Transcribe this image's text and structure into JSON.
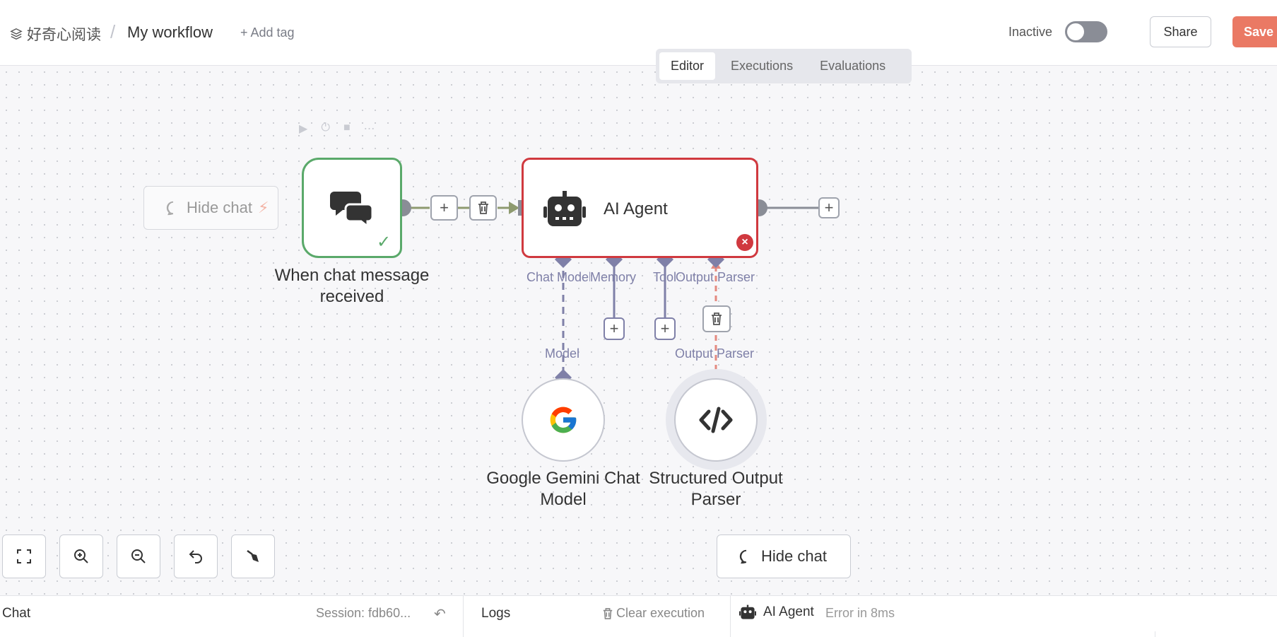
{
  "header": {
    "project_name": "好奇心阅读",
    "separator": "/",
    "workflow_name": "My workflow",
    "add_tag": "+ Add tag",
    "status_label": "Inactive",
    "share_label": "Share",
    "save_label": "Save"
  },
  "tabs": [
    {
      "label": "Editor",
      "active": true
    },
    {
      "label": "Executions",
      "active": false
    },
    {
      "label": "Evaluations",
      "active": false
    }
  ],
  "nodes": {
    "trigger": {
      "label": "When chat message received",
      "status": "success"
    },
    "agent": {
      "label": "AI Agent",
      "status": "error"
    },
    "gemini": {
      "label": "Google Gemini Chat Model"
    },
    "parser": {
      "label": "Structured Output Parser"
    }
  },
  "ports": {
    "chat_model": "Chat Model",
    "memory": "Memory",
    "tool": "Tool",
    "output_parser": "Output Parser",
    "model": "Model",
    "output_parser_in": "Output Parser"
  },
  "canvas": {
    "hide_chat_ghost": "Hide chat",
    "hide_chat": "Hide chat"
  },
  "bottom": {
    "chat_title": "Chat",
    "session": "Session: fdb60...",
    "logs_title": "Logs",
    "clear_execution": "Clear execution",
    "agent_name": "AI Agent",
    "agent_status": "Error in 8ms"
  },
  "colors": {
    "accent": "#ea7964",
    "success": "#5aa96a",
    "error": "#d0393f",
    "sub_port": "#7f80a8"
  }
}
